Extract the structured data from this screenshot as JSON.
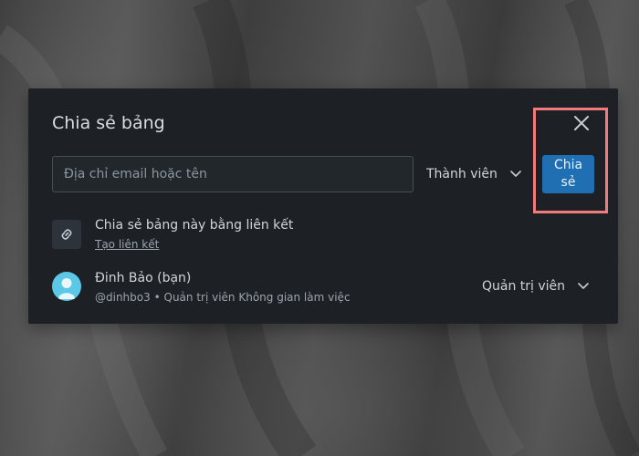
{
  "dialog": {
    "title": "Chia sẻ bảng"
  },
  "invite": {
    "email_placeholder": "Địa chỉ email hoặc tên",
    "role_label": "Thành viên",
    "share_label": "Chia sẻ"
  },
  "link": {
    "title": "Chia sẻ bảng này bằng liên kết",
    "create_label": "Tạo liên kết"
  },
  "member": {
    "name": "Đinh Bảo (bạn)",
    "username": "@dinhbo3",
    "separator": "•",
    "workspace_role": "Quản trị viên Không gian làm việc",
    "role_label": "Quản trị viên"
  },
  "icons": {
    "close": "close-icon",
    "role_chevron": "chevron-down-icon",
    "link": "link-icon",
    "member_chevron": "chevron-down-icon",
    "avatar": "user-avatar-icon"
  },
  "colors": {
    "dialog_bg": "#1d2125",
    "accent": "#1f6fb2",
    "avatar": "#5bc8e8",
    "highlight": "#f07b7b"
  }
}
